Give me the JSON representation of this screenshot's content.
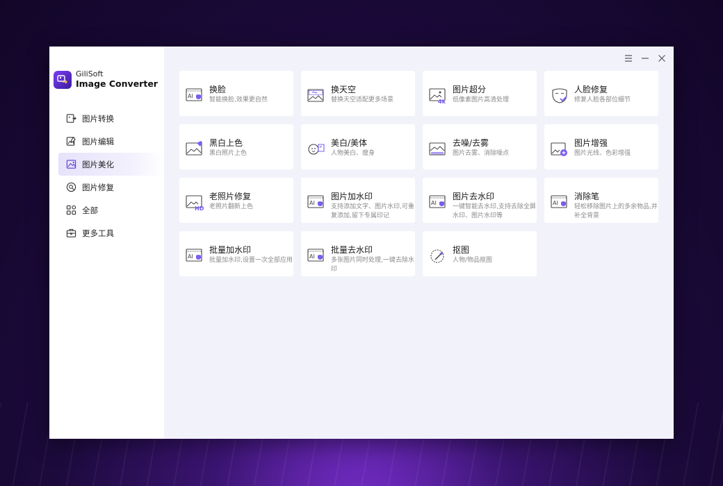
{
  "app": {
    "brand_line1": "GiliSoft",
    "brand_line2": "Image Converter"
  },
  "colors": {
    "accent": "#7b3ff2",
    "main_bg": "#f2f3fa",
    "active_nav": "#e6e2fb"
  },
  "sidebar": {
    "items": [
      {
        "label": "图片转换",
        "icon": "image-convert-icon",
        "active": false
      },
      {
        "label": "图片编辑",
        "icon": "image-edit-icon",
        "active": false
      },
      {
        "label": "图片美化",
        "icon": "image-beautify-icon",
        "active": true
      },
      {
        "label": "图片修复",
        "icon": "image-repair-icon",
        "active": false
      },
      {
        "label": "全部",
        "icon": "grid-icon",
        "active": false
      },
      {
        "label": "更多工具",
        "icon": "toolbox-icon",
        "active": false
      }
    ]
  },
  "window_controls": {
    "menu": "menu-icon",
    "minimize": "minimize-icon",
    "close": "close-icon"
  },
  "cards": [
    {
      "title": "换脸",
      "desc": "智能换脸,效果更自然",
      "icon": "ai-face-icon"
    },
    {
      "title": "换天空",
      "desc": "替换天空适配更多场景",
      "icon": "sky-icon"
    },
    {
      "title": "图片超分",
      "desc": "低像素图片高清处理",
      "icon": "image-4k-icon"
    },
    {
      "title": "人脸修复",
      "desc": "修复人脸各部位细节",
      "icon": "face-mask-icon"
    },
    {
      "title": "黑白上色",
      "desc": "黑白照片上色",
      "icon": "colorize-icon"
    },
    {
      "title": "美白/美体",
      "desc": "人物美白、瘦身",
      "icon": "beauty-icon"
    },
    {
      "title": "去噪/去雾",
      "desc": "图片去雾、消除噪点",
      "icon": "denoise-icon"
    },
    {
      "title": "图片增强",
      "desc": "图片光线、色彩增强",
      "icon": "enhance-icon"
    },
    {
      "title": "老照片修复",
      "desc": "老照片翻新上色",
      "icon": "old-photo-hd-icon"
    },
    {
      "title": "图片加水印",
      "desc": "支持添加文字、图片水印,可重复添加,留下专属印记",
      "icon": "ai-watermark-add-icon"
    },
    {
      "title": "图片去水印",
      "desc": "一键智能去水印,支持去除全屏水印、图片水印等",
      "icon": "ai-watermark-remove-icon"
    },
    {
      "title": "消除笔",
      "desc": "轻松移除图片上的多余物品,并补全背景",
      "icon": "ai-eraser-icon"
    },
    {
      "title": "批量加水印",
      "desc": "批量加水印,设置一次全部应用",
      "icon": "ai-batch-add-icon"
    },
    {
      "title": "批量去水印",
      "desc": "多张图片同时处理,一键去除水印",
      "icon": "ai-batch-remove-icon"
    },
    {
      "title": "抠图",
      "desc": "人物/物品抠图",
      "icon": "cutout-icon"
    }
  ]
}
